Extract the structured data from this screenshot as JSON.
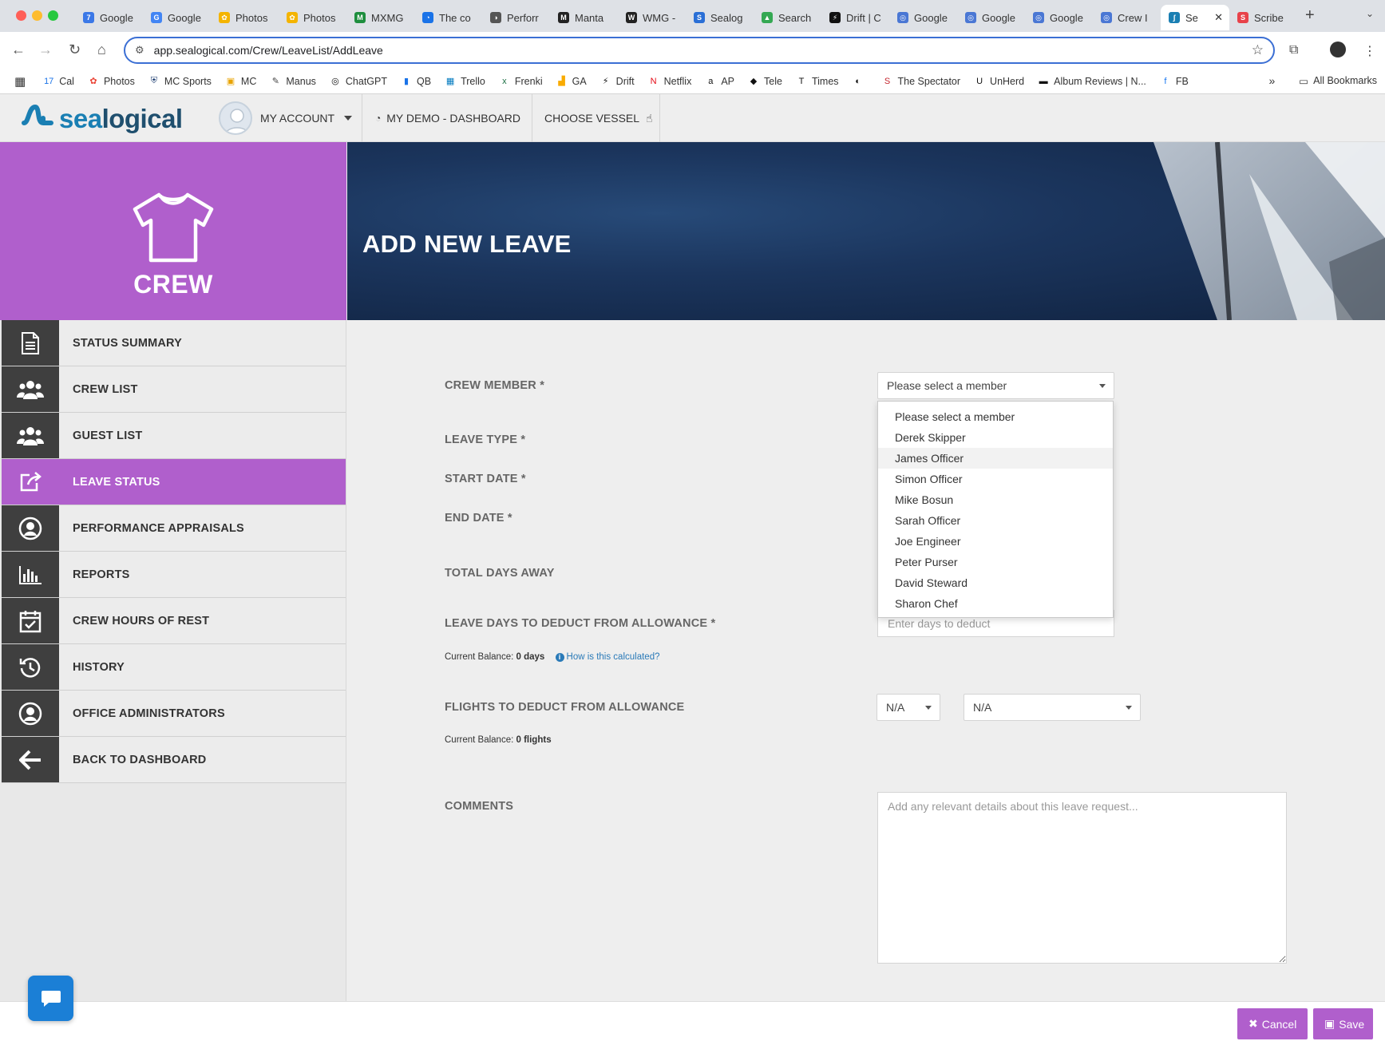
{
  "browser": {
    "tabs": [
      {
        "label": "Google",
        "color": "#3b78e7",
        "glyph": "7"
      },
      {
        "label": "Google",
        "color": "#4285f4",
        "glyph": "G"
      },
      {
        "label": "Photos",
        "color": "#f4b400",
        "glyph": "✿"
      },
      {
        "label": "Photos",
        "color": "#f4b400",
        "glyph": "✿"
      },
      {
        "label": "MXMG",
        "color": "#1e8e3e",
        "glyph": "M"
      },
      {
        "label": "The co",
        "color": "#1a73e8",
        "glyph": "◔"
      },
      {
        "label": "Perforr",
        "color": "#555555",
        "glyph": "◑"
      },
      {
        "label": "Manta",
        "color": "#222222",
        "glyph": "M"
      },
      {
        "label": "WMG -",
        "color": "#222222",
        "glyph": "W"
      },
      {
        "label": "Sealog",
        "color": "#2a6fd6",
        "glyph": "S"
      },
      {
        "label": "Search",
        "color": "#34a853",
        "glyph": "▲"
      },
      {
        "label": "Drift | C",
        "color": "#111111",
        "glyph": "⚡"
      },
      {
        "label": "Google",
        "color": "#4a77d4",
        "glyph": "◎"
      },
      {
        "label": "Google",
        "color": "#4a77d4",
        "glyph": "◎"
      },
      {
        "label": "Google",
        "color": "#4a77d4",
        "glyph": "◎"
      },
      {
        "label": "Crew I",
        "color": "#4a77d4",
        "glyph": "◎"
      },
      {
        "label": "Se",
        "color": "#1a7fb3",
        "glyph": "ʃ",
        "active": true
      },
      {
        "label": "Scribe",
        "color": "#e8424a",
        "glyph": "S"
      }
    ],
    "url": "app.sealogical.com/Crew/LeaveList/AddLeave",
    "bookmarks": [
      {
        "label": "Cal",
        "icon": "calendar-icon",
        "glyph": "17",
        "color": "#1a73e8"
      },
      {
        "label": "Photos",
        "icon": "photos-icon",
        "glyph": "✿",
        "color": "#ea4335"
      },
      {
        "label": "MC Sports",
        "icon": "shield-icon",
        "glyph": "⛨",
        "color": "#1a3a6e"
      },
      {
        "label": "MC",
        "icon": "mc-icon",
        "glyph": "▣",
        "color": "#e8a300"
      },
      {
        "label": "Manus",
        "icon": "manus-icon",
        "glyph": "✎",
        "color": "#444444"
      },
      {
        "label": "ChatGPT",
        "icon": "chatgpt-icon",
        "glyph": "◎",
        "color": "#111111"
      },
      {
        "label": "QB",
        "icon": "qb-icon",
        "glyph": "▮",
        "color": "#1a73e8"
      },
      {
        "label": "Trello",
        "icon": "trello-icon",
        "glyph": "▦",
        "color": "#0079bf"
      },
      {
        "label": "Frenki",
        "icon": "excel-icon",
        "glyph": "x",
        "color": "#1e7145"
      },
      {
        "label": "GA",
        "icon": "analytics-icon",
        "glyph": "▟",
        "color": "#f9ab00"
      },
      {
        "label": "Drift",
        "icon": "drift-icon",
        "glyph": "⚡",
        "color": "#111111"
      },
      {
        "label": "Netflix",
        "icon": "netflix-icon",
        "glyph": "N",
        "color": "#e50914"
      },
      {
        "label": "AP",
        "icon": "amazon-icon",
        "glyph": "a",
        "color": "#111111"
      },
      {
        "label": "Tele",
        "icon": "tele-icon",
        "glyph": "◆",
        "color": "#111111"
      },
      {
        "label": "Times",
        "icon": "times-icon",
        "glyph": "T",
        "color": "#111111"
      },
      {
        "label": "",
        "icon": "guardian-icon",
        "glyph": "◐",
        "color": "#111111"
      },
      {
        "label": "The Spectator",
        "icon": "spectator-icon",
        "glyph": "S",
        "color": "#c4262e"
      },
      {
        "label": "UnHerd",
        "icon": "unherd-icon",
        "glyph": "U",
        "color": "#111111"
      },
      {
        "label": "Album Reviews | N...",
        "icon": "nme-icon",
        "glyph": "▬",
        "color": "#111111"
      },
      {
        "label": "FB",
        "icon": "facebook-icon",
        "glyph": "f",
        "color": "#1877f2"
      }
    ],
    "all_bookmarks": "All Bookmarks"
  },
  "app": {
    "logo_text_a": "sea",
    "logo_text_b": "logical",
    "my_account": "MY ACCOUNT",
    "demo_dashboard": "MY DEMO - DASHBOARD",
    "choose_vessel": "CHOOSE VESSEL",
    "accent": "#b05fcc",
    "brand": "#1a7fb3"
  },
  "sidebar": {
    "title": "CREW",
    "items": [
      {
        "label": "STATUS SUMMARY",
        "icon": "document-icon"
      },
      {
        "label": "CREW LIST",
        "icon": "users-icon"
      },
      {
        "label": "GUEST LIST",
        "icon": "users-icon"
      },
      {
        "label": "LEAVE STATUS",
        "icon": "external-link-icon",
        "active": true
      },
      {
        "label": "PERFORMANCE APPRAISALS",
        "icon": "user-circle-icon"
      },
      {
        "label": "REPORTS",
        "icon": "bar-chart-icon"
      },
      {
        "label": "CREW HOURS OF REST",
        "icon": "calendar-check-icon"
      },
      {
        "label": "HISTORY",
        "icon": "history-icon"
      },
      {
        "label": "OFFICE ADMINISTRATORS",
        "icon": "user-circle-icon"
      },
      {
        "label": "BACK TO DASHBOARD",
        "icon": "arrow-left-icon"
      }
    ]
  },
  "page": {
    "title": "ADD NEW LEAVE"
  },
  "form": {
    "crew_member_label": "CREW MEMBER *",
    "crew_member_value": "Please select a member",
    "leave_type_label": "LEAVE TYPE *",
    "start_date_label": "START DATE *",
    "end_date_label": "END DATE *",
    "total_days_label": "TOTAL DAYS AWAY",
    "deduct_days_label": "LEAVE DAYS TO DEDUCT FROM ALLOWANCE *",
    "deduct_days_placeholder": "Enter days to deduct",
    "balance_prefix": "Current Balance:",
    "balance_days": "0 days",
    "how_calculated": "How is this calculated?",
    "flights_label": "FLIGHTS TO DEDUCT FROM ALLOWANCE",
    "flights_select_a": "N/A",
    "flights_select_b": "N/A",
    "balance_flights": "0 flights",
    "comments_label": "COMMENTS",
    "comments_placeholder": "Add any relevant details about this leave request..."
  },
  "dropdown": {
    "options": [
      "Please select a member",
      "Derek Skipper",
      "James Officer",
      "Simon Officer",
      "Mike Bosun",
      "Sarah Officer",
      "Joe Engineer",
      "Peter Purser",
      "David Steward",
      "Sharon Chef"
    ],
    "highlighted_index": 2
  },
  "footer": {
    "cancel": "Cancel",
    "save": "Save"
  }
}
